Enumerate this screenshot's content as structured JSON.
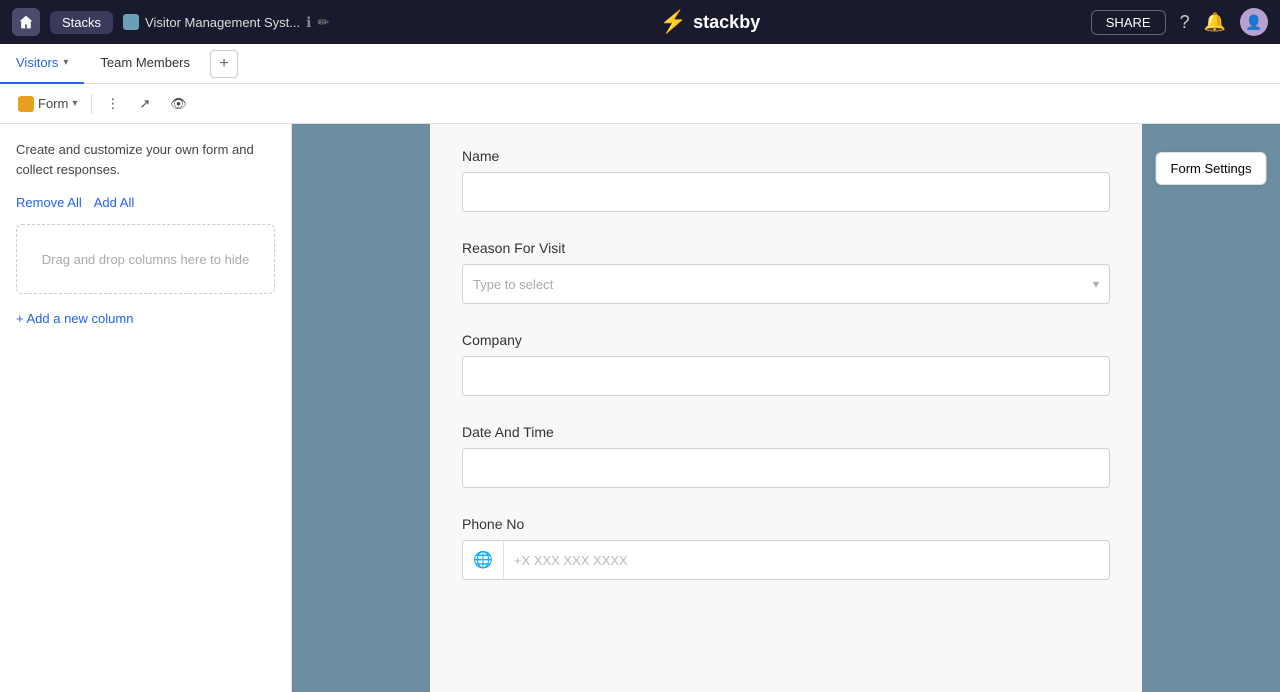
{
  "topNav": {
    "stacksLabel": "Stacks",
    "projectName": "Visitor Management Syst...",
    "logoText": "stackby",
    "shareLabel": "SHARE",
    "helpIcon": "?",
    "notifIcon": "🔔"
  },
  "tabs": [
    {
      "id": "visitors",
      "label": "Visitors",
      "active": true
    },
    {
      "id": "team",
      "label": "Team Members",
      "active": false
    }
  ],
  "toolbar": {
    "viewLabel": "Form",
    "formSettingsLabel": "Form Settings"
  },
  "sidebar": {
    "description": "Create and customize your own form and collect responses.",
    "removeAllLabel": "Remove All",
    "addAllLabel": "Add All",
    "dropZoneText": "Drag and drop columns here to hide",
    "addColumnLabel": "+ Add a new column"
  },
  "formFields": [
    {
      "id": "name",
      "label": "Name",
      "type": "text",
      "placeholder": ""
    },
    {
      "id": "reason",
      "label": "Reason For Visit",
      "type": "select",
      "placeholder": "Type to select"
    },
    {
      "id": "company",
      "label": "Company",
      "type": "text",
      "placeholder": ""
    },
    {
      "id": "datetime",
      "label": "Date And Time",
      "type": "text",
      "placeholder": ""
    },
    {
      "id": "phone",
      "label": "Phone No",
      "type": "phone",
      "placeholder": "+X XXX XXX XXXX"
    }
  ],
  "colors": {
    "accent": "#2563eb",
    "navBg": "#1a1a2e",
    "formBg": "#6b8fa0",
    "tabActiveBorder": "#2563eb"
  }
}
